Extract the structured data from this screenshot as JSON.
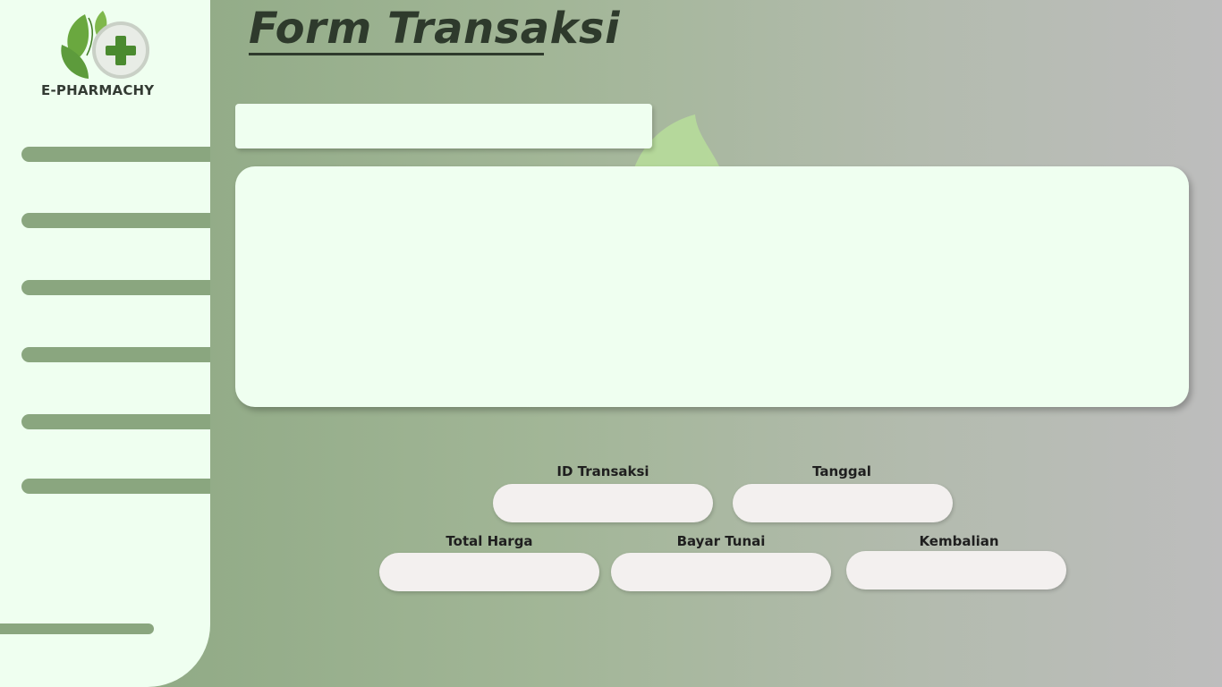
{
  "brand": {
    "name": "E-PHARMACHY",
    "logo_icon": "leaf-cross-logo-icon",
    "colors": {
      "leaf": "#5d9b3c",
      "cross": "#4a8a2f",
      "ring": "#c9d0c6"
    }
  },
  "colors": {
    "sidebar_bg": "#effff0",
    "accent": "#8aa67f",
    "title": "#2e3a2c",
    "input_bg": "#f3f0ef"
  },
  "sidebar": {
    "nav_items": [
      {
        "label": ""
      },
      {
        "label": ""
      },
      {
        "label": ""
      },
      {
        "label": ""
      },
      {
        "label": ""
      },
      {
        "label": ""
      }
    ],
    "logout_label": ""
  },
  "page": {
    "title": "Form Transaksi"
  },
  "search": {
    "value": "",
    "placeholder": ""
  },
  "form": {
    "id_transaksi": {
      "label": "ID Transaksi",
      "value": ""
    },
    "tanggal": {
      "label": "Tanggal",
      "value": ""
    },
    "total_harga": {
      "label": "Total Harga",
      "value": ""
    },
    "bayar_tunai": {
      "label": "Bayar Tunai",
      "value": ""
    },
    "kembalian": {
      "label": "Kembalian",
      "value": ""
    }
  }
}
